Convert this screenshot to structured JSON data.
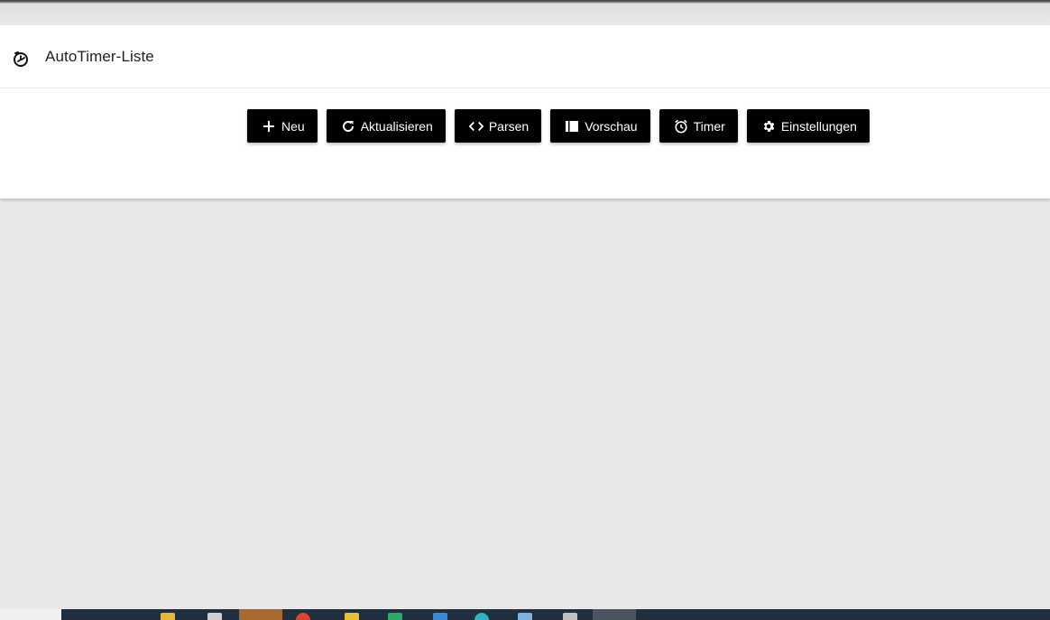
{
  "header": {
    "title": "AutoTimer-Liste",
    "icon": "autotimer-icon"
  },
  "toolbar": {
    "buttons": [
      {
        "label": "Neu",
        "icon": "plus-icon"
      },
      {
        "label": "Aktualisieren",
        "icon": "refresh-icon"
      },
      {
        "label": "Parsen",
        "icon": "code-icon"
      },
      {
        "label": "Vorschau",
        "icon": "preview-icon"
      },
      {
        "label": "Timer",
        "icon": "alarm-clock-icon"
      },
      {
        "label": "Einstellungen",
        "icon": "gear-icon"
      }
    ]
  },
  "colors": {
    "button_bg": "#000000",
    "button_text": "#ffffff",
    "page_bg": "#e8e8e8",
    "card_bg": "#ffffff",
    "taskbar_bg": "#1f2f3d"
  }
}
